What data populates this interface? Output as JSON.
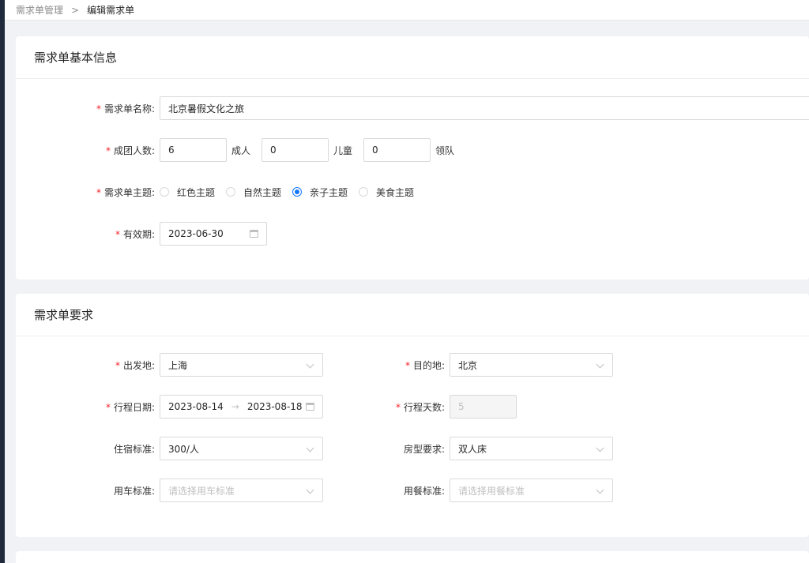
{
  "breadcrumb": {
    "parent": "需求单管理",
    "current": "编辑需求单"
  },
  "basic": {
    "title": "需求单基本信息",
    "name": {
      "label": "需求单名称:",
      "value": "北京暑假文化之旅"
    },
    "group": {
      "label": "成团人数:",
      "adults": {
        "value": "6",
        "unit": "成人"
      },
      "children": {
        "value": "0",
        "unit": "儿童"
      },
      "leaders": {
        "value": "0",
        "unit": "领队"
      }
    },
    "theme": {
      "label": "需求单主题:",
      "options": [
        "红色主题",
        "自然主题",
        "亲子主题",
        "美食主题"
      ],
      "selected": "亲子主题"
    },
    "validity": {
      "label": "有效期:",
      "value": "2023-06-30"
    }
  },
  "requirements": {
    "title": "需求单要求",
    "departure": {
      "label": "出发地:",
      "value": "上海"
    },
    "destination": {
      "label": "目的地:",
      "value": "北京"
    },
    "trip_dates": {
      "label": "行程日期:",
      "start": "2023-08-14",
      "end": "2023-08-18",
      "arrow": "→"
    },
    "trip_days": {
      "label": "行程天数:",
      "value": "5"
    },
    "hotel_standard": {
      "label": "住宿标准:",
      "value": "300/人"
    },
    "room_type": {
      "label": "房型要求:",
      "value": "双人床"
    },
    "car_standard": {
      "label": "用车标准:",
      "placeholder": "请选择用车标准"
    },
    "meal_standard": {
      "label": "用餐标准:",
      "placeholder": "请选择用餐标准"
    }
  },
  "colors": {
    "required": "#f5222d",
    "accent": "#1677ff",
    "page_bg": "#f0f2f5"
  }
}
